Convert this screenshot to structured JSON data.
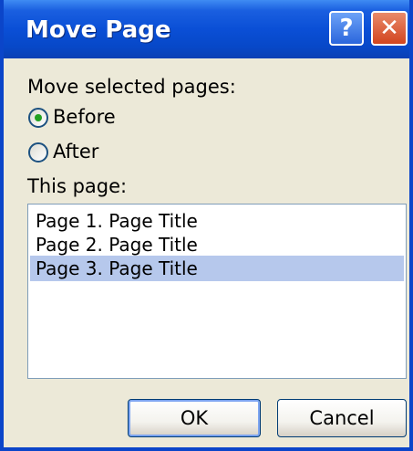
{
  "window": {
    "title": "Move Page",
    "help_glyph": "?",
    "close_glyph": "✕",
    "title_bar_color": "#0a4fd6",
    "close_button_color": "#d2451f",
    "background_color": "#ece9d8"
  },
  "move_selected": {
    "label": "Move selected pages:",
    "options": [
      {
        "label": "Before",
        "selected": true
      },
      {
        "label": "After",
        "selected": false
      }
    ]
  },
  "this_page": {
    "label": "This page:",
    "items": [
      {
        "label": "Page 1. Page Title",
        "selected": false
      },
      {
        "label": "Page 2. Page Title",
        "selected": false
      },
      {
        "label": "Page 3. Page Title",
        "selected": true
      }
    ],
    "selection_color": "#b6c8ec"
  },
  "buttons": {
    "ok_label": "OK",
    "cancel_label": "Cancel"
  },
  "icons": {
    "help": "help-icon",
    "close": "close-icon",
    "radio_selected": "radio-selected-icon",
    "radio_unselected": "radio-unselected-icon"
  }
}
